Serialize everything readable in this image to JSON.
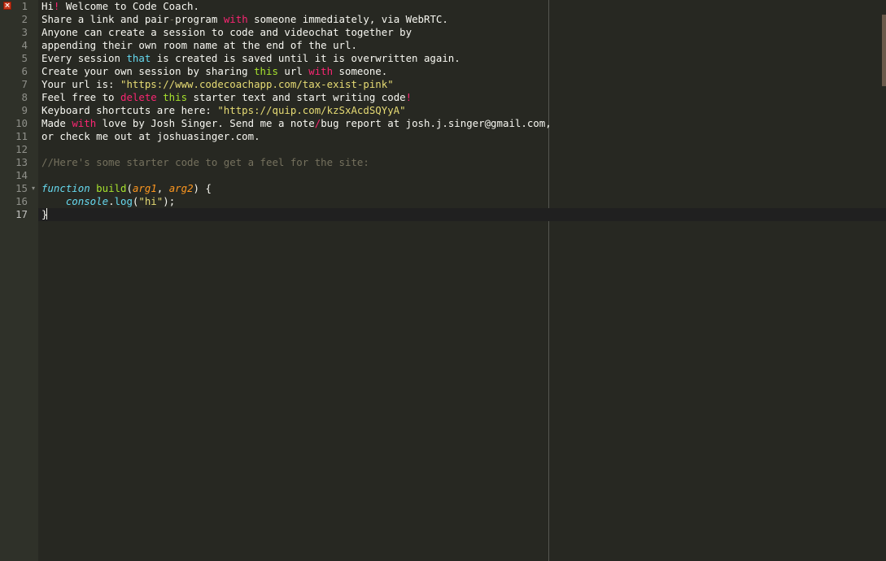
{
  "editor": {
    "gutter": {
      "line_numbers": [
        "1",
        "2",
        "3",
        "4",
        "5",
        "6",
        "7",
        "8",
        "9",
        "10",
        "11",
        "12",
        "13",
        "14",
        "15",
        "16",
        "17"
      ],
      "error_icon": "×",
      "fold_marker": "▾"
    },
    "lines": [
      [
        {
          "t": "Hi"
        },
        {
          "t": "!",
          "c": "red"
        },
        {
          "t": " Welcome to Code Coach."
        }
      ],
      [
        {
          "t": "Share a link and pair"
        },
        {
          "t": "-",
          "c": "gray"
        },
        {
          "t": "program "
        },
        {
          "t": "with",
          "c": "red"
        },
        {
          "t": " someone immediately, via WebRTC."
        }
      ],
      [
        {
          "t": "Anyone can create a session to code and videochat together by"
        }
      ],
      [
        {
          "t": "appending their own room name at the end of the url."
        }
      ],
      [
        {
          "t": "Every session "
        },
        {
          "t": "that",
          "c": "blue"
        },
        {
          "t": " is created is saved until it is overwritten again."
        }
      ],
      [
        {
          "t": "Create your own session by sharing "
        },
        {
          "t": "this",
          "c": "green"
        },
        {
          "t": " url "
        },
        {
          "t": "with",
          "c": "red"
        },
        {
          "t": " someone."
        }
      ],
      [
        {
          "t": "Your url is: "
        },
        {
          "t": "\"https://www.codecoachapp.com/tax-exist-pink\"",
          "c": "yellow"
        }
      ],
      [
        {
          "t": "Feel free to "
        },
        {
          "t": "delete",
          "c": "red"
        },
        {
          "t": " "
        },
        {
          "t": "this",
          "c": "green"
        },
        {
          "t": " starter text and start writing code"
        },
        {
          "t": "!",
          "c": "red"
        }
      ],
      [
        {
          "t": "Keyboard shortcuts are here: "
        },
        {
          "t": "\"https://quip.com/kzSxAcdSQYyA\"",
          "c": "yellow"
        }
      ],
      [
        {
          "t": "Made "
        },
        {
          "t": "with",
          "c": "red"
        },
        {
          "t": " love by Josh Singer. Send me a note"
        },
        {
          "t": "/",
          "c": "red"
        },
        {
          "t": "bug report at josh.j.singer@gmail.com,"
        }
      ],
      [
        {
          "t": "or check me out at joshuasinger.com."
        }
      ],
      [],
      [
        {
          "t": "//Here's some starter code to get a feel for the site:",
          "c": "comment"
        }
      ],
      [],
      [
        {
          "t": "function",
          "c": "blue-it"
        },
        {
          "t": " "
        },
        {
          "t": "build",
          "c": "green"
        },
        {
          "t": "("
        },
        {
          "t": "arg1",
          "c": "orange-it"
        },
        {
          "t": ", "
        },
        {
          "t": "arg2",
          "c": "orange-it"
        },
        {
          "t": ") {"
        }
      ],
      [
        {
          "t": "    "
        },
        {
          "t": "console",
          "c": "blue-it"
        },
        {
          "t": "."
        },
        {
          "t": "log",
          "c": "blue"
        },
        {
          "t": "("
        },
        {
          "t": "\"hi\"",
          "c": "yellow"
        },
        {
          "t": ");"
        }
      ],
      [
        {
          "t": "}"
        }
      ]
    ],
    "active_line": 17,
    "error_line": 1,
    "fold_line": 15,
    "colors": {
      "background": "#272822",
      "gutter": "#2f3129",
      "keyword": "#f92672",
      "storage": "#66d9ef",
      "function_name": "#a6e22e",
      "string": "#e6db74",
      "parameter": "#fd971f",
      "comment": "#75715e"
    }
  }
}
